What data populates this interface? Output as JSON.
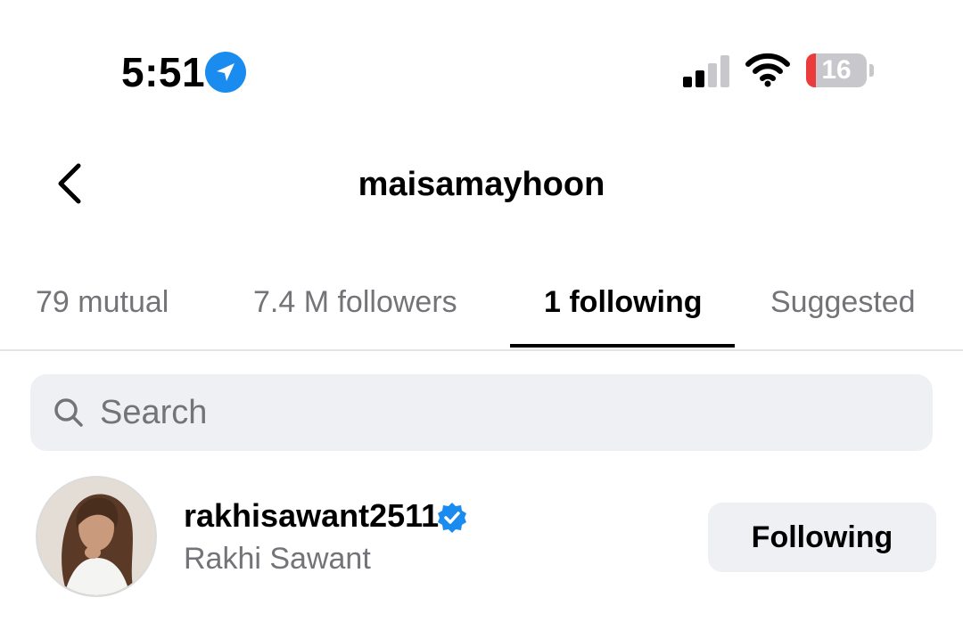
{
  "status_bar": {
    "time": "5:51",
    "battery_level": "16",
    "battery_color": "#ec3b3b",
    "location_icon": "location-arrow-icon",
    "signal_bars_active": 2,
    "signal_bars_total": 4
  },
  "header": {
    "title": "maisamayhoon",
    "back_icon": "chevron-left-icon"
  },
  "tabs": [
    {
      "label": "79 mutual",
      "active": false
    },
    {
      "label": "7.4 M followers",
      "active": false
    },
    {
      "label": "1 following",
      "active": true
    },
    {
      "label": "Suggested",
      "active": false
    }
  ],
  "search": {
    "placeholder": "Search",
    "value": ""
  },
  "list": [
    {
      "username": "rakhisawant2511",
      "full_name": "Rakhi Sawant",
      "verified": true,
      "verified_color": "#1a8cf0",
      "button_label": "Following"
    }
  ],
  "colors": {
    "accent_blue": "#1a8cf0",
    "secondary_text": "#737378",
    "button_bg": "#eff0f4"
  }
}
